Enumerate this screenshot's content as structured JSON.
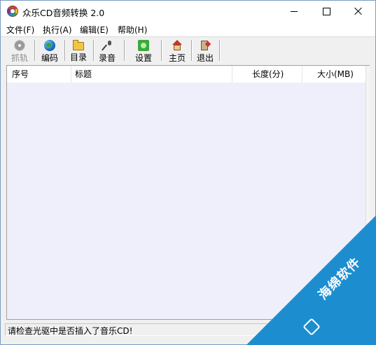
{
  "window": {
    "title": "众乐CD音频转换 2.0",
    "icon": "cd-disc-icon"
  },
  "menu": {
    "items": [
      "文件(F)",
      "执行(A)",
      "编辑(E)",
      "帮助(H)"
    ]
  },
  "toolbar": {
    "buttons": [
      {
        "label": "抓轨",
        "icon": "cd-rip-icon",
        "enabled": false
      },
      {
        "label": "编码",
        "icon": "globe-icon",
        "enabled": true
      },
      {
        "label": "目录",
        "icon": "folder-icon",
        "enabled": true
      },
      {
        "label": "录音",
        "icon": "microphone-icon",
        "enabled": true
      },
      {
        "label": "设置",
        "icon": "settings-icon",
        "enabled": true
      },
      {
        "label": "主页",
        "icon": "home-icon",
        "enabled": true
      },
      {
        "label": "退出",
        "icon": "exit-icon",
        "enabled": true
      }
    ]
  },
  "list": {
    "columns": [
      "序号",
      "标题",
      "长度(分)",
      "大小(MB)"
    ],
    "rows": []
  },
  "status": {
    "message": "请检查光驱中是否插入了音乐CD!"
  },
  "watermark": {
    "text": "海绵软件"
  },
  "colors": {
    "list_background": "#eeeffa",
    "watermark_blue": "#1c8ed0"
  }
}
